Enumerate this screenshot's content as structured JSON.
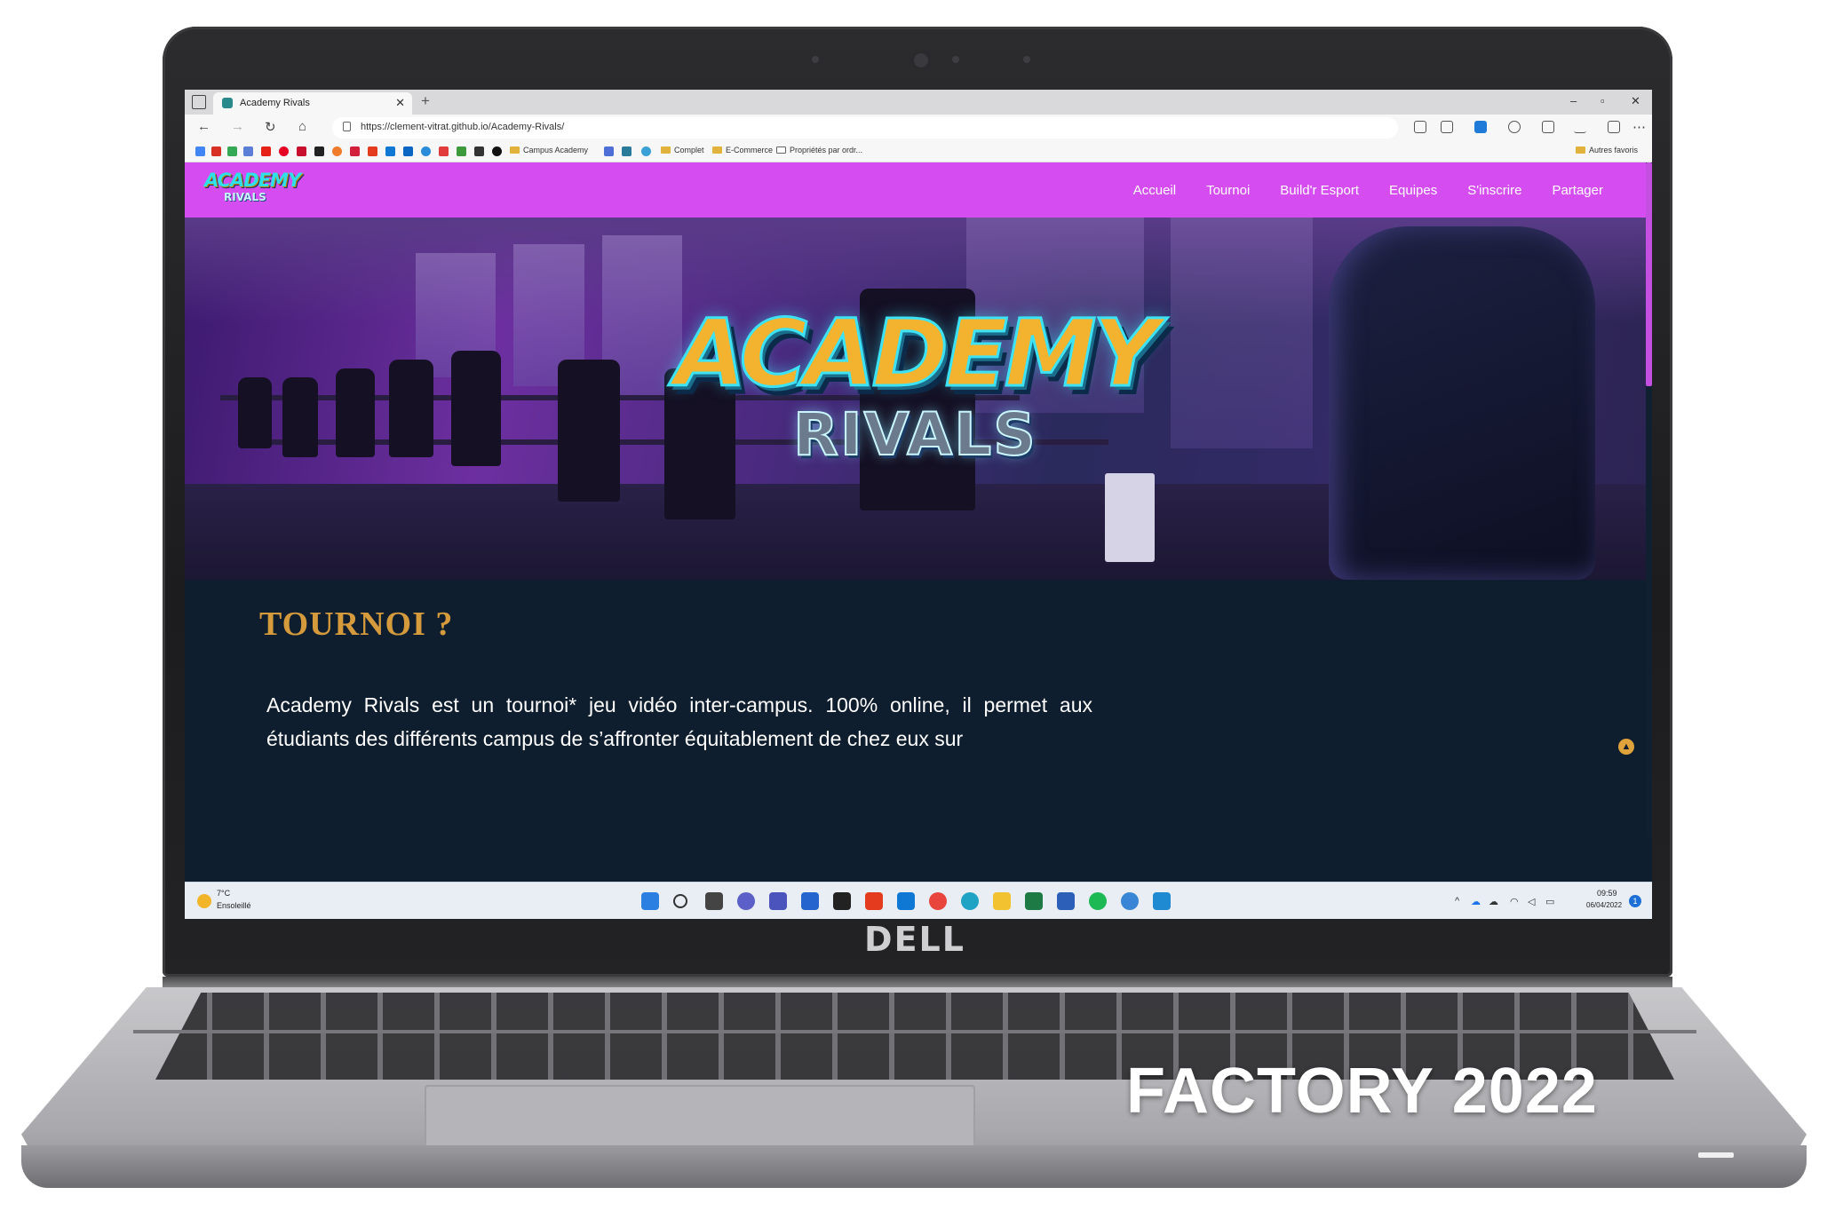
{
  "device": {
    "brand_label": "DELL",
    "caption": "FACTORY 2022"
  },
  "browser": {
    "tab_title": "Academy Rivals",
    "url": "https://clement-vitrat.github.io/Academy-Rivals/",
    "favorites": {
      "folder_1": "Campus Academy",
      "folder_2": "Complet",
      "folder_3": "E-Commerce",
      "item_4": "Propriétés par ordr...",
      "other": "Autres favoris"
    }
  },
  "site": {
    "logo_line1": "ACADEMY",
    "logo_line2": "RIVALS",
    "nav": [
      "Accueil",
      "Tournoi",
      "Build'r Esport",
      "Equipes",
      "S'inscrire",
      "Partager"
    ],
    "hero_title_line1": "ACADEMY",
    "hero_title_line2": "RIVALS",
    "section_title": "TOURNOI ?",
    "section_text": "Academy Rivals est un tournoi* jeu vidéo inter-campus. 100% online, il permet aux étudiants des différents campus de s’affronter équitablement de chez eux sur"
  },
  "taskbar": {
    "temperature": "7°C",
    "weather": "Ensoleillé",
    "time": "09:59",
    "date": "06/04/2022",
    "notification_count": "1"
  },
  "colors": {
    "nav_bg": "#d54df0",
    "content_bg": "#0f1e2e",
    "title_accent": "#d49a3c"
  }
}
